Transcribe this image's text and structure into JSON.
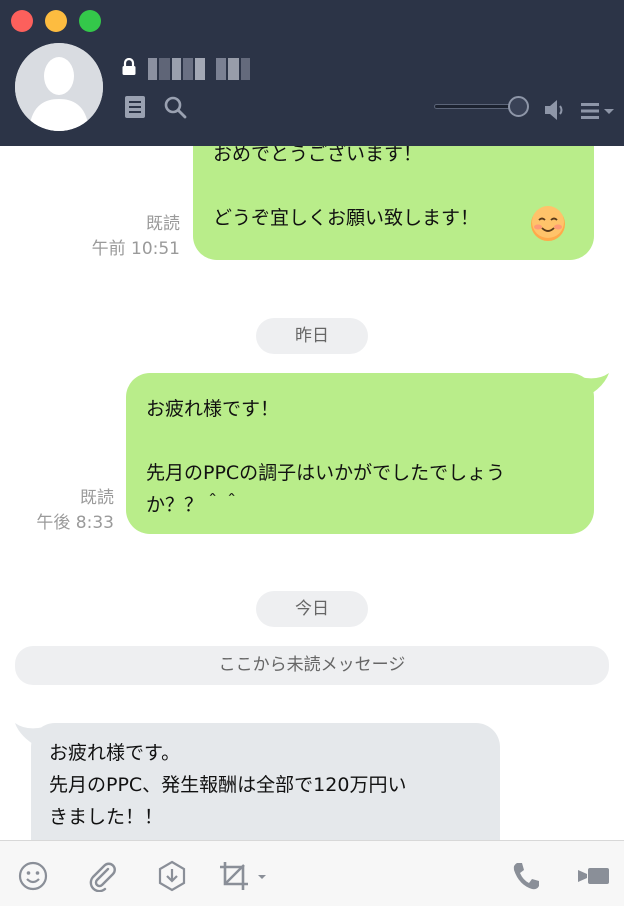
{
  "header": {
    "contact_name_redacted": true,
    "icons": [
      "lock-icon",
      "note-icon",
      "search-icon",
      "volume-icon",
      "menu-icon"
    ],
    "volume_level": 1.0
  },
  "messages": [
    {
      "direction": "sent",
      "lines": [
        "おめでとうございます！",
        "",
        "どうぞ宜しくお願い致します！"
      ],
      "emoji": "smiling-face-emoji",
      "read": "既読",
      "time": "午前 10:51"
    },
    {
      "type": "date",
      "label": "昨日"
    },
    {
      "direction": "sent",
      "lines": [
        "お疲れ様です！",
        "",
        "先月のPPCの調子はいかがでしたでしょう",
        "か？？＾＾"
      ],
      "read": "既読",
      "time": "午後 8:33"
    },
    {
      "type": "date",
      "label": "今日"
    },
    {
      "type": "unread_marker",
      "label": "ここから未読メッセージ"
    },
    {
      "direction": "received",
      "lines": [
        "お疲れ様です。",
        "先月のPPC、発生報酬は全部で120万円い",
        "きました！！"
      ]
    }
  ],
  "footer": {
    "icons": [
      "emoji-icon",
      "attach-icon",
      "keep-icon",
      "screenshot-icon",
      "call-icon",
      "video-call-icon"
    ]
  },
  "colors": {
    "header_bg": "#2c3447",
    "sent_bubble": "#b9ed8a",
    "received_bubble": "#e5e8eb",
    "pill_bg": "#eeeff1"
  }
}
